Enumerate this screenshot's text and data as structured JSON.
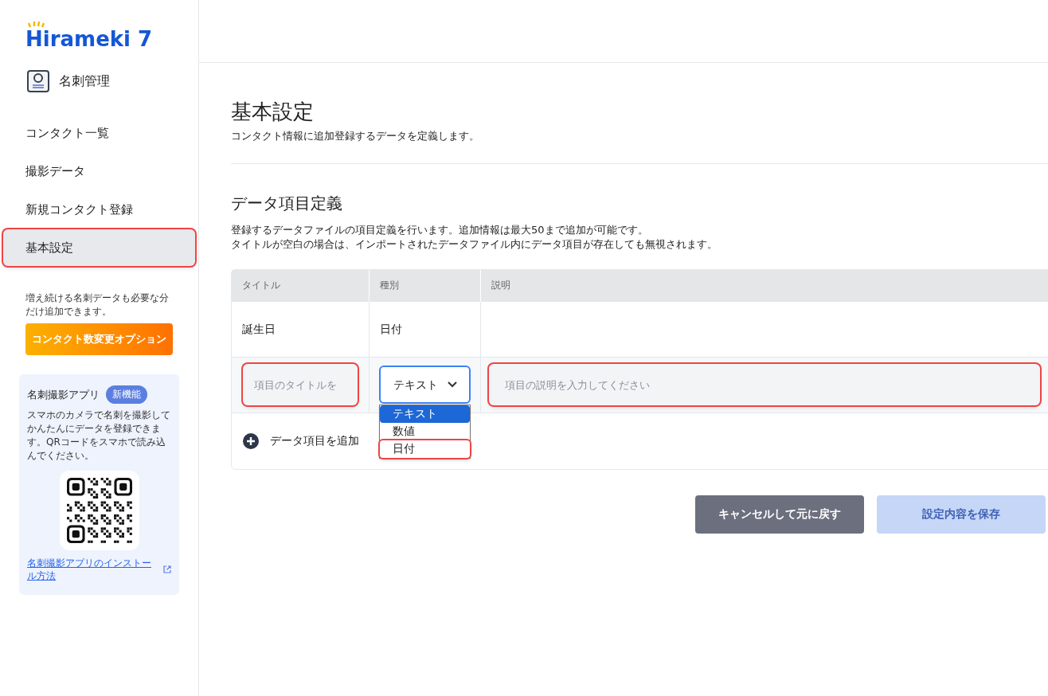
{
  "sidebar": {
    "logo": "Hirameki 7",
    "app_title": "名刺管理",
    "items": [
      {
        "label": "コンタクト一覧",
        "selected": false,
        "highlighted": false
      },
      {
        "label": "撮影データ",
        "selected": false,
        "highlighted": false
      },
      {
        "label": "新規コンタクト登録",
        "selected": false,
        "highlighted": false
      },
      {
        "label": "基本設定",
        "selected": true,
        "highlighted": true
      }
    ],
    "promo_text": "増え続ける名刺データも必要な分だけ追加できます。",
    "promo_button": "コンタクト数変更オプション",
    "app_card": {
      "title": "名刺撮影アプリ",
      "badge": "新機能",
      "text": "スマホのカメラで名刺を撮影してかんたんにデータを登録できます。QRコードをスマホで読み込んでください。",
      "link": "名刺撮影アプリのインストール方法"
    }
  },
  "page": {
    "title": "基本設定",
    "subtitle": "コンタクト情報に追加登録するデータを定義します。",
    "section_title": "データ項目定義",
    "section_text": [
      "登録するデータファイルの項目定義を行います。追加情報は最大50まで追加が可能です。",
      "タイトルが空白の場合は、インポートされたデータファイル内にデータ項目が存在しても無視されます。"
    ],
    "table": {
      "columns": [
        "タイトル",
        "種別",
        "説明"
      ],
      "rows": [
        {
          "title": "誕生日",
          "type": "日付"
        }
      ],
      "new_row": {
        "title_placeholder": "項目のタイトルを",
        "title_highlighted": true,
        "type_value": "テキスト",
        "description_placeholder": "項目の説明を入力してください",
        "description_highlighted": true,
        "type_options": [
          {
            "label": "テキスト",
            "selected": true,
            "highlighted": false
          },
          {
            "label": "数値",
            "selected": false,
            "highlighted": false
          },
          {
            "label": "日付",
            "selected": false,
            "highlighted": true
          }
        ]
      },
      "add_button": "データ項目を追加"
    },
    "buttons": [
      {
        "label": "キャンセルして元に戻す",
        "kind": "secondary",
        "disabled": false
      },
      {
        "label": "設定内容を保存",
        "kind": "primary",
        "disabled": true
      }
    ]
  }
}
